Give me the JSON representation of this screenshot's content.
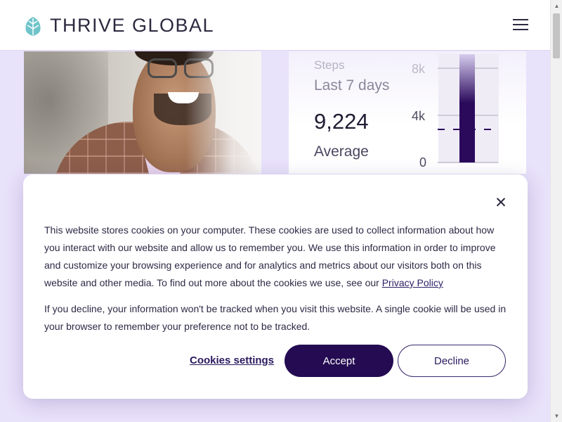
{
  "brand": {
    "name": "THRIVE GLOBAL",
    "logo_color": "#6fc4c9"
  },
  "header": {
    "menu_icon": "hamburger-menu-icon"
  },
  "steps_card": {
    "title": "Steps",
    "period": "Last 7 days",
    "value": "9,224",
    "value_caption": "Average",
    "chart": {
      "tick_labels": [
        "8k",
        "4k",
        "0"
      ],
      "bar_color": "#2b0a5c"
    }
  },
  "cookie_banner": {
    "close_icon": "close-icon",
    "paragraph_1": "This website stores cookies on your computer. These cookies are used to collect information about how you interact with our website and allow us to remember you. We use this information in order to improve and customize your browsing experience and for analytics and metrics about our visitors both on this website and other media. To find out more about the cookies we use, see our ",
    "privacy_link": "Privacy Policy",
    "paragraph_2": "If you decline, your information won't be tracked when you visit this website. A single cookie will be used in your browser to remember your preference not to be tracked.",
    "settings_label": "Cookies settings",
    "accept_label": "Accept",
    "decline_label": "Decline",
    "accent_color": "#240b52"
  }
}
